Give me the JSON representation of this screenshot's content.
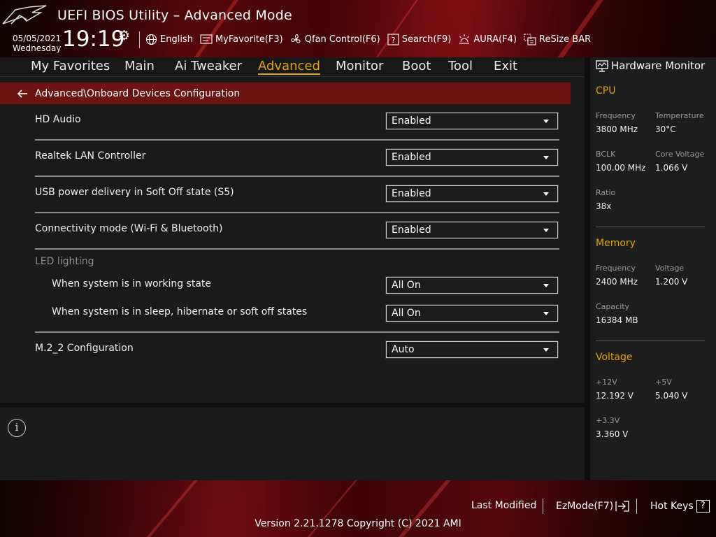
{
  "window": {
    "title": "UEFI BIOS Utility – Advanced Mode"
  },
  "datetime": {
    "date": "05/05/2021",
    "weekday": "Wednesday",
    "time": "19:19"
  },
  "toolbar": [
    {
      "icon": "globe-icon",
      "label": "English"
    },
    {
      "icon": "myfavorite-icon",
      "label": "MyFavorite(F3)"
    },
    {
      "icon": "fan-icon",
      "label": "Qfan Control(F6)"
    },
    {
      "icon": "search-icon",
      "label": "Search(F9)"
    },
    {
      "icon": "aura-icon",
      "label": "AURA(F4)"
    },
    {
      "icon": "resize-bar-icon",
      "label": "ReSize BAR"
    }
  ],
  "nav": {
    "tabs": [
      "My Favorites",
      "Main",
      "Ai Tweaker",
      "Advanced",
      "Monitor",
      "Boot",
      "Tool",
      "Exit"
    ],
    "active": "Advanced"
  },
  "breadcrumb": "Advanced\\Onboard Devices Configuration",
  "settings": {
    "hd_audio": {
      "label": "HD Audio",
      "value": "Enabled"
    },
    "lan": {
      "label": "Realtek LAN Controller",
      "value": "Enabled"
    },
    "usb_power": {
      "label": "USB power delivery in Soft Off state (S5)",
      "value": "Enabled"
    },
    "connectivity": {
      "label": "Connectivity mode (Wi-Fi & Bluetooth)",
      "value": "Enabled"
    },
    "led_section": "LED lighting",
    "led_working": {
      "label": "When system is in working state",
      "value": "All On"
    },
    "led_sleep": {
      "label": "When system is in sleep, hibernate or soft off states",
      "value": "All On"
    },
    "m2": {
      "label": "M.2_2 Configuration",
      "value": "Auto"
    }
  },
  "help": {
    "icon": "info-icon",
    "glyph": "i"
  },
  "hardware_monitor": {
    "title": "Hardware Monitor",
    "cpu": {
      "title": "CPU",
      "frequency_label": "Frequency",
      "frequency": "3800 MHz",
      "temperature_label": "Temperature",
      "temperature": "30°C",
      "bclk_label": "BCLK",
      "bclk": "100.00 MHz",
      "core_voltage_label": "Core Voltage",
      "core_voltage": "1.066 V",
      "ratio_label": "Ratio",
      "ratio": "38x"
    },
    "memory": {
      "title": "Memory",
      "frequency_label": "Frequency",
      "frequency": "2400 MHz",
      "voltage_label": "Voltage",
      "voltage": "1.200 V",
      "capacity_label": "Capacity",
      "capacity": "16384 MB"
    },
    "voltage": {
      "title": "Voltage",
      "v12_label": "+12V",
      "v12": "12.192 V",
      "v5_label": "+5V",
      "v5": "5.040 V",
      "v33_label": "+3.3V",
      "v33": "3.360 V"
    }
  },
  "footer": {
    "last_modified": "Last Modified",
    "ezmode": "EzMode(F7)",
    "hotkeys": "Hot Keys",
    "hotkeys_key": "?",
    "version": "Version 2.21.1278 Copyright (C) 2021 AMI"
  },
  "colors": {
    "accent": "#e2a400",
    "breadcrumb_bg": "#6b1411",
    "brand_red": "#9a1016"
  }
}
